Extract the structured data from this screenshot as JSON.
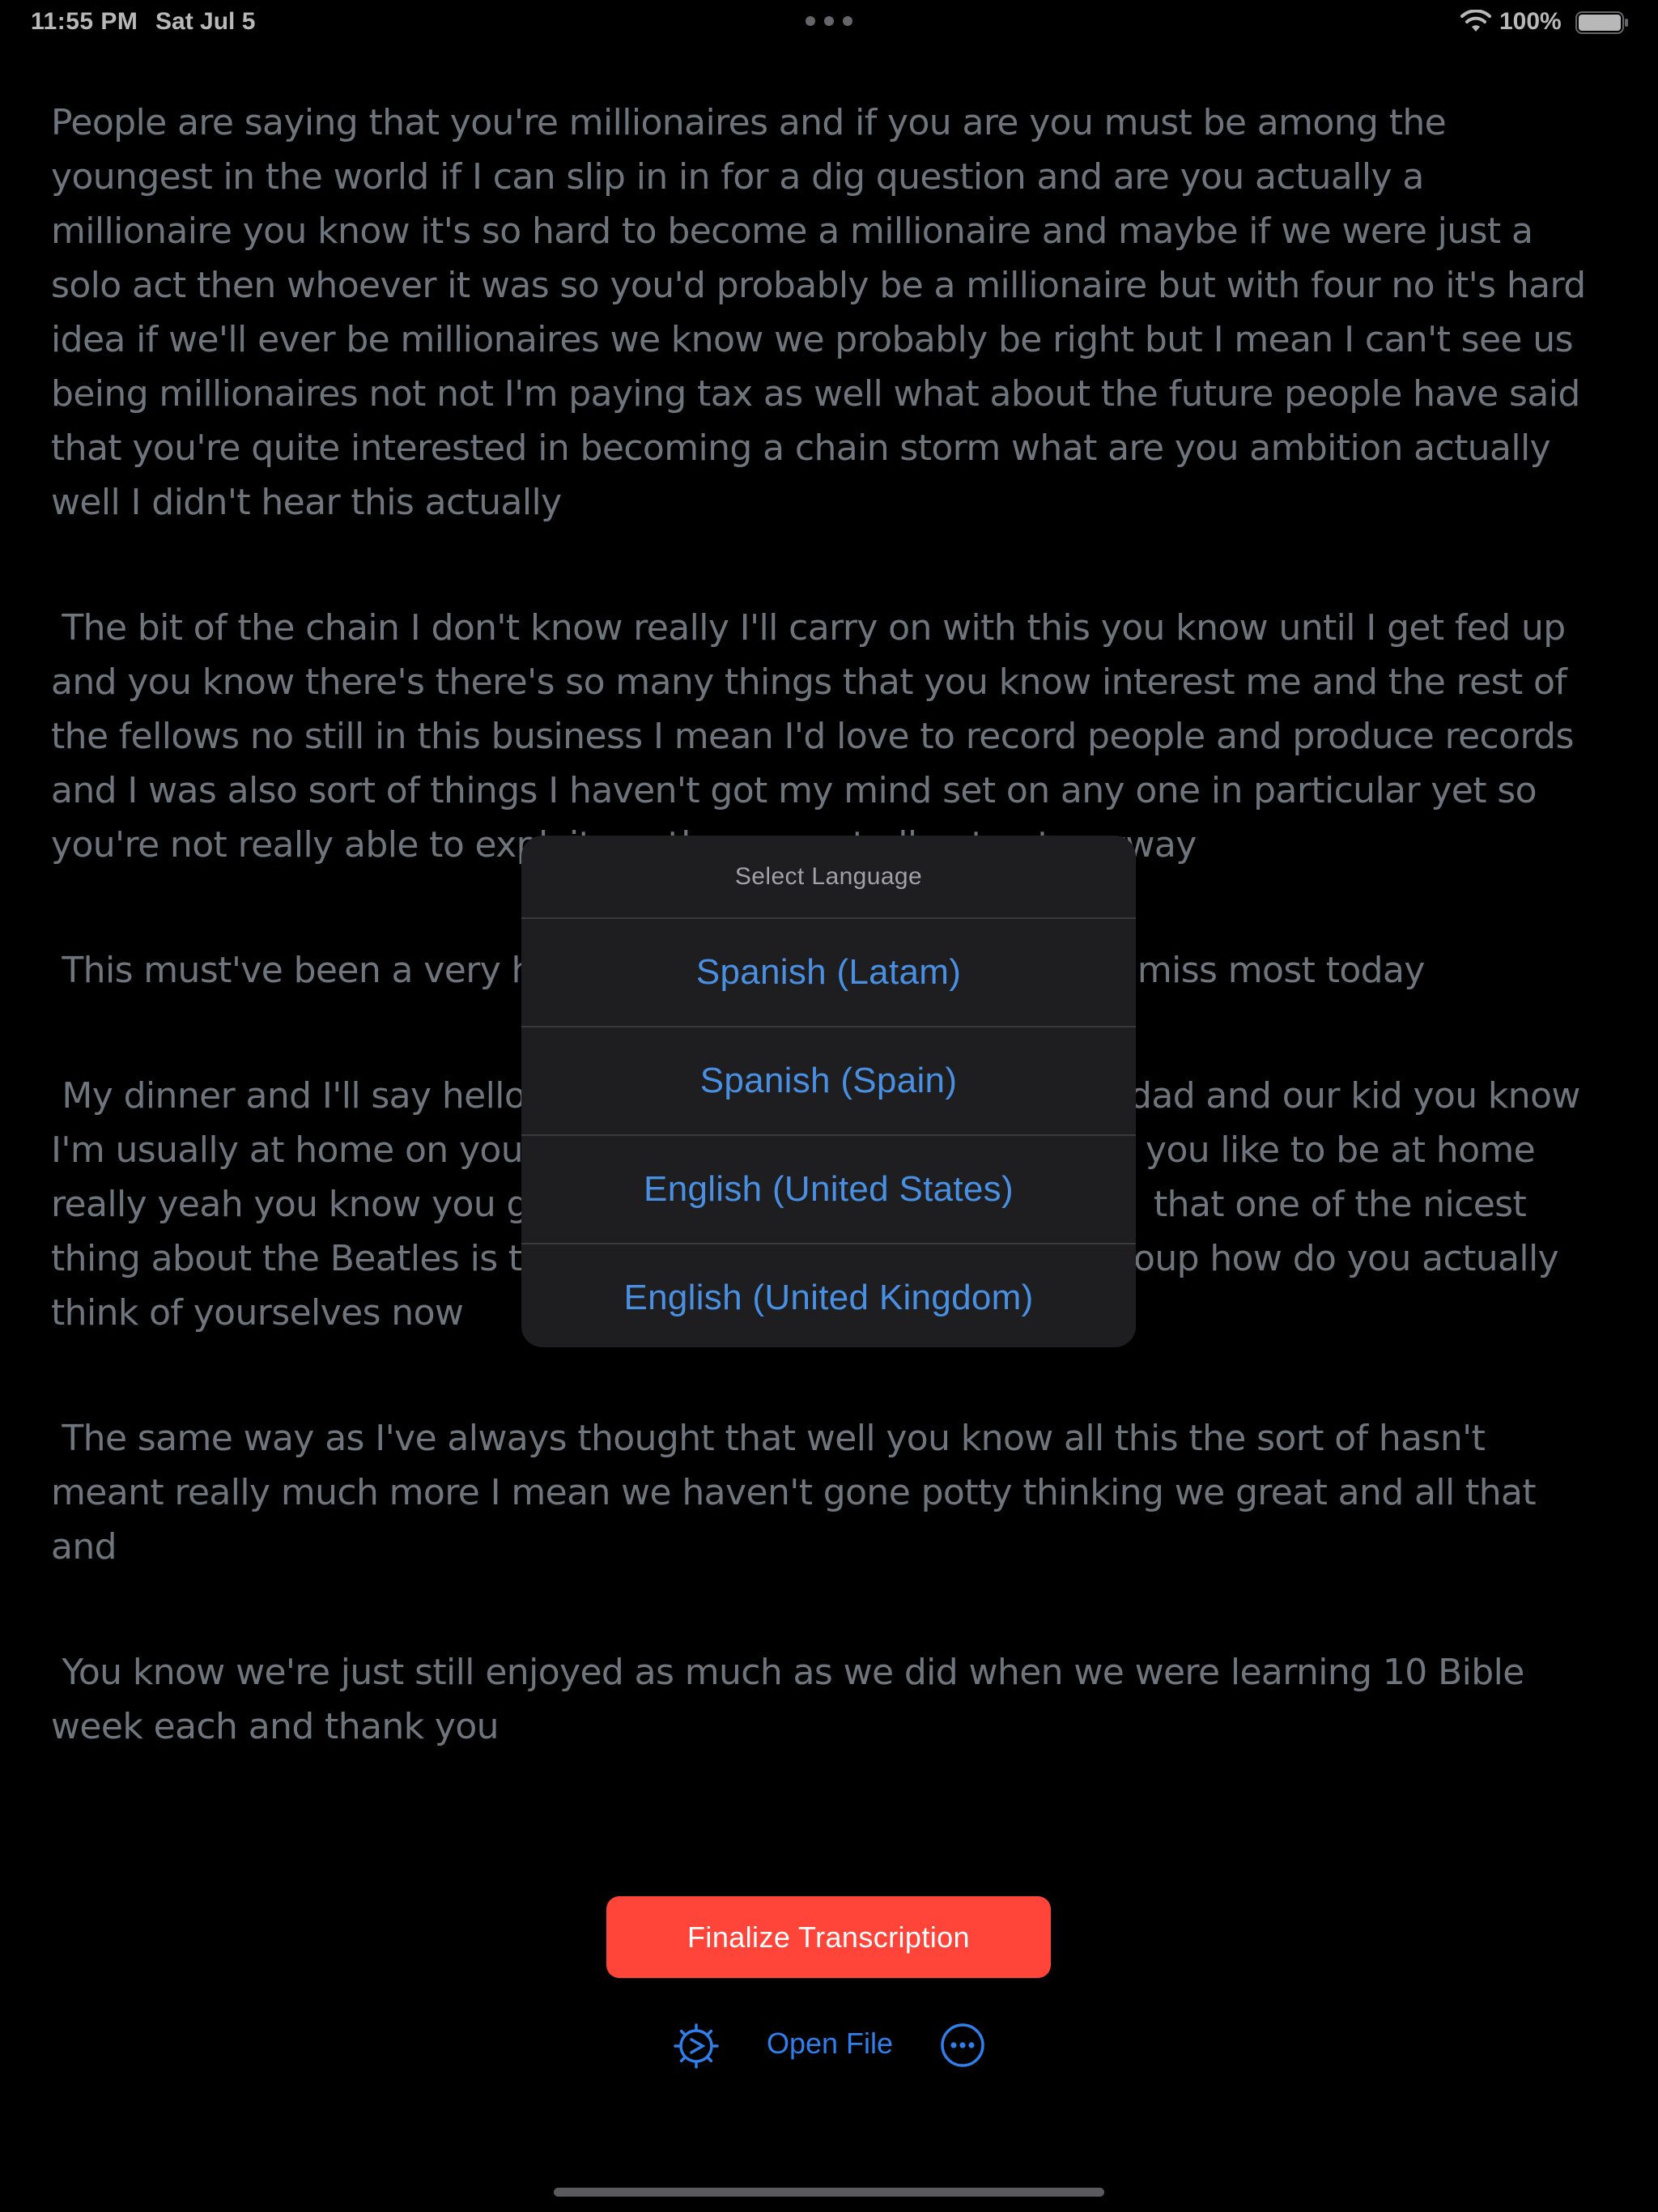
{
  "status_bar": {
    "time": "11:55 PM",
    "date": "Sat Jul 5",
    "battery": "100%"
  },
  "transcript": {
    "paragraphs": [
      "People are saying that you're millionaires and if you are you must be among the youngest in the world if I can slip in in for a dig question and are you actually a millionaire you know it's so hard to become a millionaire and maybe if we were just a solo act then whoever it was so you'd probably be a millionaire but with four no it's hard idea if we'll ever be millionaires we know we probably be right but I mean I can't see us being millionaires not not I'm paying tax as well what about the future people have said that you're quite interested in becoming a chain storm what are you ambition actually well I didn't hear this actually",
      " The bit of the chain I don't know really I'll carry on with this you know until I get fed up and you know there's there's so many things that you know interest me and the rest of the fellows no still in this business I mean I'd love to record people and produce records and I was also sort of things I haven't got my mind set on any one in particular yet so you're not really able to exploit another way at all not yet anyway",
      " This must've been a very hec",
      " My dinner and I'll say hello t",
      " The same way as I've always thought that well you know all this the sort of hasn't meant really much more I mean we haven't gone potty thinking we great and all that and",
      " You know we're just still enjoyed as much as we did when we were learning 10 Bible week each and thank you"
    ],
    "partial_right": {
      "line3": "ctually miss most today",
      "line4a": "dad and our kid you know",
      "line4b_left": "I'm usually at home on your",
      "line4b_right": "you like to be at home",
      "line4c_left": "really yeah you know you ge",
      "line4c_right": "that one of the nicest",
      "line4d_left": "thing about the Beatles is th",
      "line4d_right": "oup how do you actually",
      "line4e": "think of yourselves now"
    }
  },
  "language_sheet": {
    "title": "Select Language",
    "options": [
      "Spanish (Latam)",
      "Spanish (Spain)",
      "English (United States)",
      "English (United Kingdom)"
    ]
  },
  "controls": {
    "finalize_label": "Finalize Transcription",
    "open_file_label": "Open File",
    "settings_icon": "gear-waveform-icon",
    "more_icon": "ellipsis-circle-icon"
  },
  "colors": {
    "accent": "#2f80ed",
    "finalize": "#ff453a",
    "text": "#9aa3ad",
    "sheet_bg": "#1e1e20"
  }
}
